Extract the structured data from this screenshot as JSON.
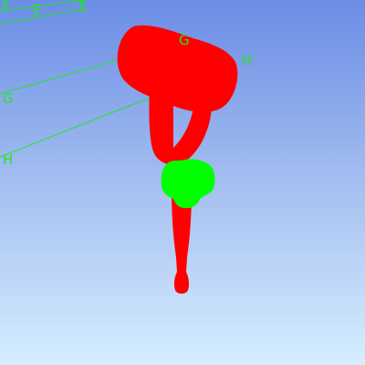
{
  "viewport": {
    "background_top": "#6b8de6",
    "background_bottom": "#d6eeff"
  },
  "colors": {
    "model": "#ff0000",
    "highlight": "#00ff00",
    "annotation": "#22e622"
  },
  "annotations": {
    "e_left": "E",
    "e_mid": "E",
    "e_right": "E",
    "g_left": "G",
    "g_right": "G",
    "h_left": "H",
    "h_right": "H"
  }
}
